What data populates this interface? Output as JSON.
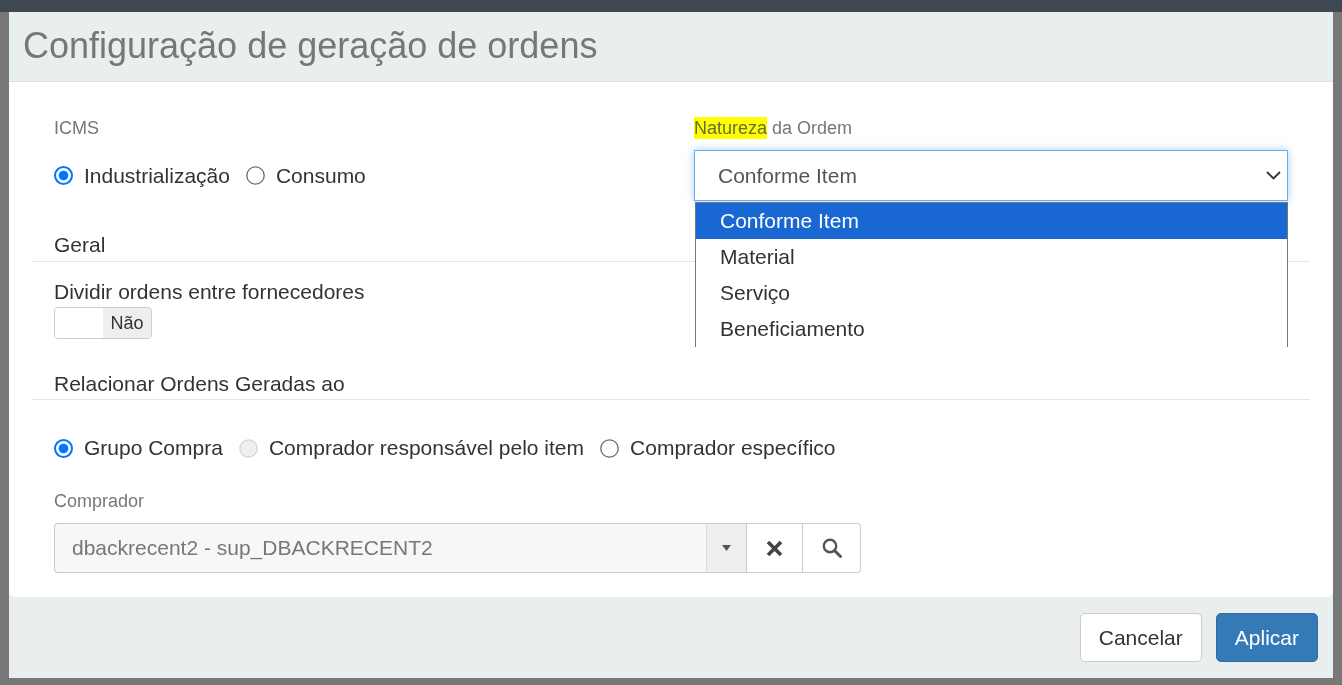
{
  "window": {
    "title": "Configuração de geração de ordens"
  },
  "icms": {
    "label": "ICMS",
    "options": [
      {
        "label": "Industrialização",
        "selected": true
      },
      {
        "label": "Consumo",
        "selected": false
      }
    ]
  },
  "order_nature": {
    "label_parts": [
      {
        "text": "Natureza",
        "highlighted": true
      },
      {
        "text": " da Ordem",
        "highlighted": false
      }
    ],
    "value": "Conforme Item",
    "expanded": true,
    "options": [
      {
        "label": "Conforme Item",
        "selected": true
      },
      {
        "label": "Material",
        "selected": false
      },
      {
        "label": "Serviço",
        "selected": false
      },
      {
        "label": "Beneficiamento",
        "selected": false
      }
    ]
  },
  "general": {
    "title": "Geral",
    "split_orders": {
      "label": "Dividir ordens entre fornecedores",
      "on": false,
      "state_text": "Não"
    }
  },
  "relate": {
    "title": "Relacionar Ordens Geradas ao",
    "options": [
      {
        "label": "Grupo Compra",
        "selected": true,
        "disabled": false
      },
      {
        "label": "Comprador responsável pelo item",
        "selected": false,
        "disabled": true
      },
      {
        "label": "Comprador específico",
        "selected": false,
        "disabled": false
      }
    ]
  },
  "buyer": {
    "label": "Comprador",
    "value": "dbackrecent2 - sup_DBACKRECENT2"
  },
  "buttons": [
    {
      "label": "Cancelar",
      "kind": "secondary"
    },
    {
      "label": "Aplicar",
      "kind": "primary"
    }
  ]
}
